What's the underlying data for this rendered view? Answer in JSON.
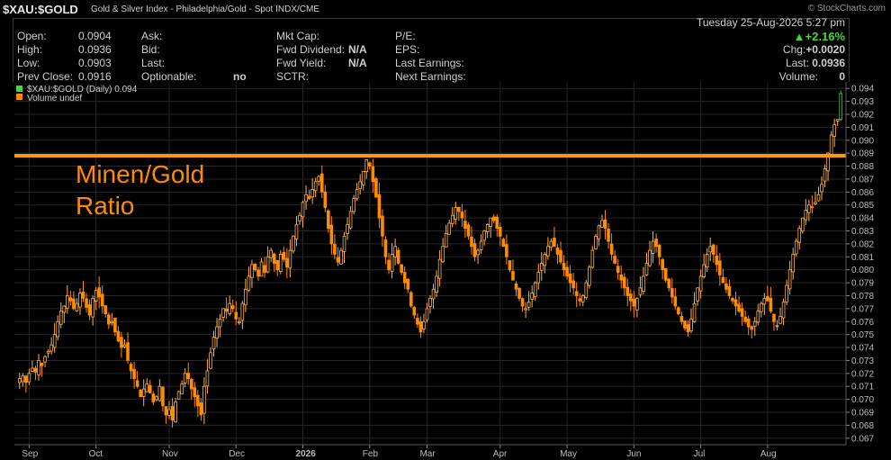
{
  "header": {
    "ticker": "$XAU:$GOLD",
    "subtitle": "Gold & Silver Index - Philadelphia/Gold - Spot  INDX/CME",
    "credit": "© StockCharts.com"
  },
  "quote_panel": {
    "col1": [
      {
        "label": "Open:",
        "value": "0.0904"
      },
      {
        "label": "High:",
        "value": "0.0936"
      },
      {
        "label": "Low:",
        "value": "0.0903"
      },
      {
        "label": "Prev Close:",
        "value": "0.0916"
      }
    ],
    "col2": [
      {
        "label": "Ask:",
        "value": ""
      },
      {
        "label": "Bid:",
        "value": ""
      },
      {
        "label": "Last:",
        "value": ""
      },
      {
        "label": "Optionable:",
        "value": "no"
      }
    ],
    "col3": [
      {
        "label": "Mkt Cap:",
        "value": ""
      },
      {
        "label": "Fwd Dividend:",
        "value": "N/A"
      },
      {
        "label": "Fwd Yield:",
        "value": "N/A"
      },
      {
        "label": "SCTR:",
        "value": ""
      }
    ],
    "col4": [
      {
        "label": "P/E:",
        "value": ""
      },
      {
        "label": "EPS:",
        "value": ""
      },
      {
        "label": "Last Earnings:",
        "value": ""
      },
      {
        "label": "Next Earnings:",
        "value": ""
      }
    ],
    "date_line": "Tuesday  25-Aug-2026  5:27 pm",
    "change_pct": "+2.16%",
    "chg_label": "Chg:",
    "chg_value": "+0.0020",
    "last_label": "Last:",
    "last_value": "0.0936",
    "volume_label": "Volume:",
    "volume_value": "0",
    "up_color": "#45d83a"
  },
  "chart_data": {
    "type": "candlestick",
    "legend": [
      {
        "text": "$XAU:$GOLD (Daily) 0.094",
        "color": "#45d83a"
      },
      {
        "text": "Volume undef",
        "color": "#ff8c00"
      }
    ],
    "annotation": [
      "Minen/Gold",
      "Ratio"
    ],
    "resistance_level": 0.0888,
    "resistance_color": "#ff9900",
    "ylim": [
      0.0665,
      0.0945
    ],
    "y_ticks": [
      "0.094",
      "0.093",
      "0.092",
      "0.091",
      "0.090",
      "0.089",
      "0.088",
      "0.087",
      "0.086",
      "0.085",
      "0.084",
      "0.083",
      "0.082",
      "0.081",
      "0.080",
      "0.079",
      "0.078",
      "0.077",
      "0.076",
      "0.075",
      "0.074",
      "0.073",
      "0.072",
      "0.071",
      "0.070",
      "0.069",
      "0.068",
      "0.067"
    ],
    "x_labels": [
      {
        "label": "Sep",
        "bar": 3
      },
      {
        "label": "Oct",
        "bar": 24
      },
      {
        "label": "Nov",
        "bar": 47
      },
      {
        "label": "Dec",
        "bar": 68
      },
      {
        "label": "2026",
        "bar": 89
      },
      {
        "label": "Feb",
        "bar": 110
      },
      {
        "label": "Mar",
        "bar": 128
      },
      {
        "label": "Apr",
        "bar": 151
      },
      {
        "label": "May",
        "bar": 172
      },
      {
        "label": "Jun",
        "bar": 193
      },
      {
        "label": "Jul",
        "bar": 214
      },
      {
        "label": "Aug",
        "bar": 235
      }
    ],
    "close": [
      0.0716,
      0.0718,
      0.0713,
      0.072,
      0.0724,
      0.0721,
      0.073,
      0.0726,
      0.0733,
      0.0737,
      0.0742,
      0.075,
      0.076,
      0.0768,
      0.0772,
      0.078,
      0.0776,
      0.077,
      0.0774,
      0.0782,
      0.0778,
      0.0771,
      0.0765,
      0.0778,
      0.0784,
      0.0779,
      0.0772,
      0.0766,
      0.0758,
      0.076,
      0.0752,
      0.0745,
      0.074,
      0.0742,
      0.073,
      0.0722,
      0.0716,
      0.071,
      0.0702,
      0.0708,
      0.0712,
      0.0705,
      0.0698,
      0.0702,
      0.071,
      0.0695,
      0.0688,
      0.0692,
      0.0684,
      0.0698,
      0.0706,
      0.0712,
      0.072,
      0.0716,
      0.0708,
      0.0702,
      0.0695,
      0.0688,
      0.071,
      0.0722,
      0.0736,
      0.0748,
      0.0756,
      0.0762,
      0.077,
      0.0768,
      0.0774,
      0.077,
      0.0762,
      0.076,
      0.0774,
      0.0785,
      0.0795,
      0.0804,
      0.08,
      0.0795,
      0.0806,
      0.0798,
      0.081,
      0.0815,
      0.0805,
      0.08,
      0.0812,
      0.0808,
      0.0802,
      0.0815,
      0.0826,
      0.0835,
      0.0842,
      0.0852,
      0.0858,
      0.0855,
      0.0862,
      0.0868,
      0.0872,
      0.086,
      0.0848,
      0.0832,
      0.082,
      0.0812,
      0.0806,
      0.0815,
      0.0826,
      0.0835,
      0.0845,
      0.0855,
      0.0862,
      0.0868,
      0.0876,
      0.0885,
      0.088,
      0.0868,
      0.0856,
      0.084,
      0.0826,
      0.081,
      0.08,
      0.0812,
      0.0818,
      0.0805,
      0.0798,
      0.079,
      0.0785,
      0.0772,
      0.0765,
      0.0758,
      0.0752,
      0.076,
      0.077,
      0.0778,
      0.0785,
      0.0795,
      0.0808,
      0.0818,
      0.0828,
      0.0836,
      0.0842,
      0.0848,
      0.0845,
      0.084,
      0.0832,
      0.0826,
      0.0818,
      0.081,
      0.0815,
      0.0822,
      0.083,
      0.0835,
      0.084,
      0.0838,
      0.0832,
      0.0826,
      0.0818,
      0.081,
      0.08,
      0.0792,
      0.0785,
      0.0778,
      0.0772,
      0.077,
      0.0775,
      0.0782,
      0.079,
      0.0798,
      0.0805,
      0.0812,
      0.0818,
      0.0822,
      0.0818,
      0.0812,
      0.0806,
      0.08,
      0.0795,
      0.079,
      0.0786,
      0.078,
      0.0776,
      0.078,
      0.079,
      0.0802,
      0.0815,
      0.0826,
      0.0834,
      0.0838,
      0.0832,
      0.0822,
      0.0812,
      0.0805,
      0.0798,
      0.0792,
      0.0786,
      0.078,
      0.0776,
      0.0772,
      0.0778,
      0.0786,
      0.0795,
      0.0805,
      0.0815,
      0.0822,
      0.0818,
      0.081,
      0.08,
      0.0792,
      0.0786,
      0.0779,
      0.0772,
      0.0766,
      0.076,
      0.0755,
      0.0752,
      0.0762,
      0.0774,
      0.0786,
      0.0795,
      0.0804,
      0.0812,
      0.0818,
      0.0812,
      0.0804,
      0.0796,
      0.079,
      0.0785,
      0.078,
      0.0776,
      0.0772,
      0.0768,
      0.0764,
      0.076,
      0.0756,
      0.0754,
      0.076,
      0.0768,
      0.0774,
      0.0778,
      0.0776,
      0.0768,
      0.076,
      0.0756,
      0.0764,
      0.0775,
      0.0788,
      0.08,
      0.0812,
      0.0822,
      0.0832,
      0.084,
      0.0846,
      0.085,
      0.0848,
      0.0852,
      0.0858,
      0.0866,
      0.0878,
      0.089,
      0.0904,
      0.0912,
      0.0916,
      0.0936
    ]
  }
}
